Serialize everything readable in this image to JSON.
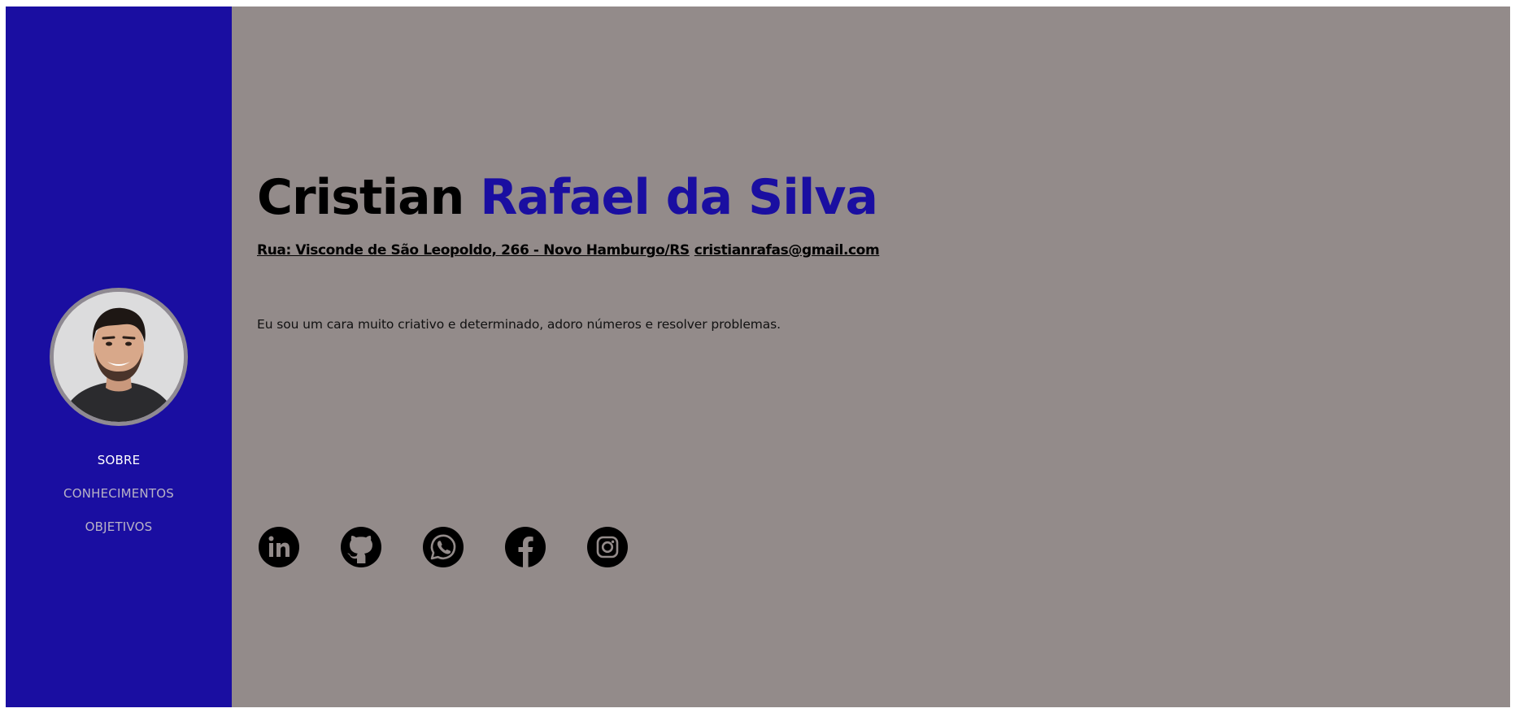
{
  "sidebar": {
    "nav": [
      {
        "label": "SOBRE",
        "active": true
      },
      {
        "label": "CONHECIMENTOS",
        "active": false
      },
      {
        "label": "OBJETIVOS",
        "active": false
      }
    ]
  },
  "hero": {
    "first_name": "Cristian",
    "last_name": "Rafael da Silva",
    "address": "Rua: Visconde de São Leopoldo, 266 - Novo Hamburgo/RS",
    "email": "cristianrafas@gmail.com",
    "bio": "Eu sou um cara muito criativo e determinado, adoro números e resolver problemas."
  },
  "socials": [
    "linkedin-icon",
    "github-icon",
    "whatsapp-icon",
    "facebook-icon",
    "instagram-icon"
  ],
  "colors": {
    "sidebar_bg": "#1a0ea1",
    "main_bg": "#938b8a",
    "accent": "#1a0ea1",
    "nav_active": "#ffffff",
    "nav_inactive": "#b8b3c6",
    "avatar_ring": "#8f8a92"
  }
}
